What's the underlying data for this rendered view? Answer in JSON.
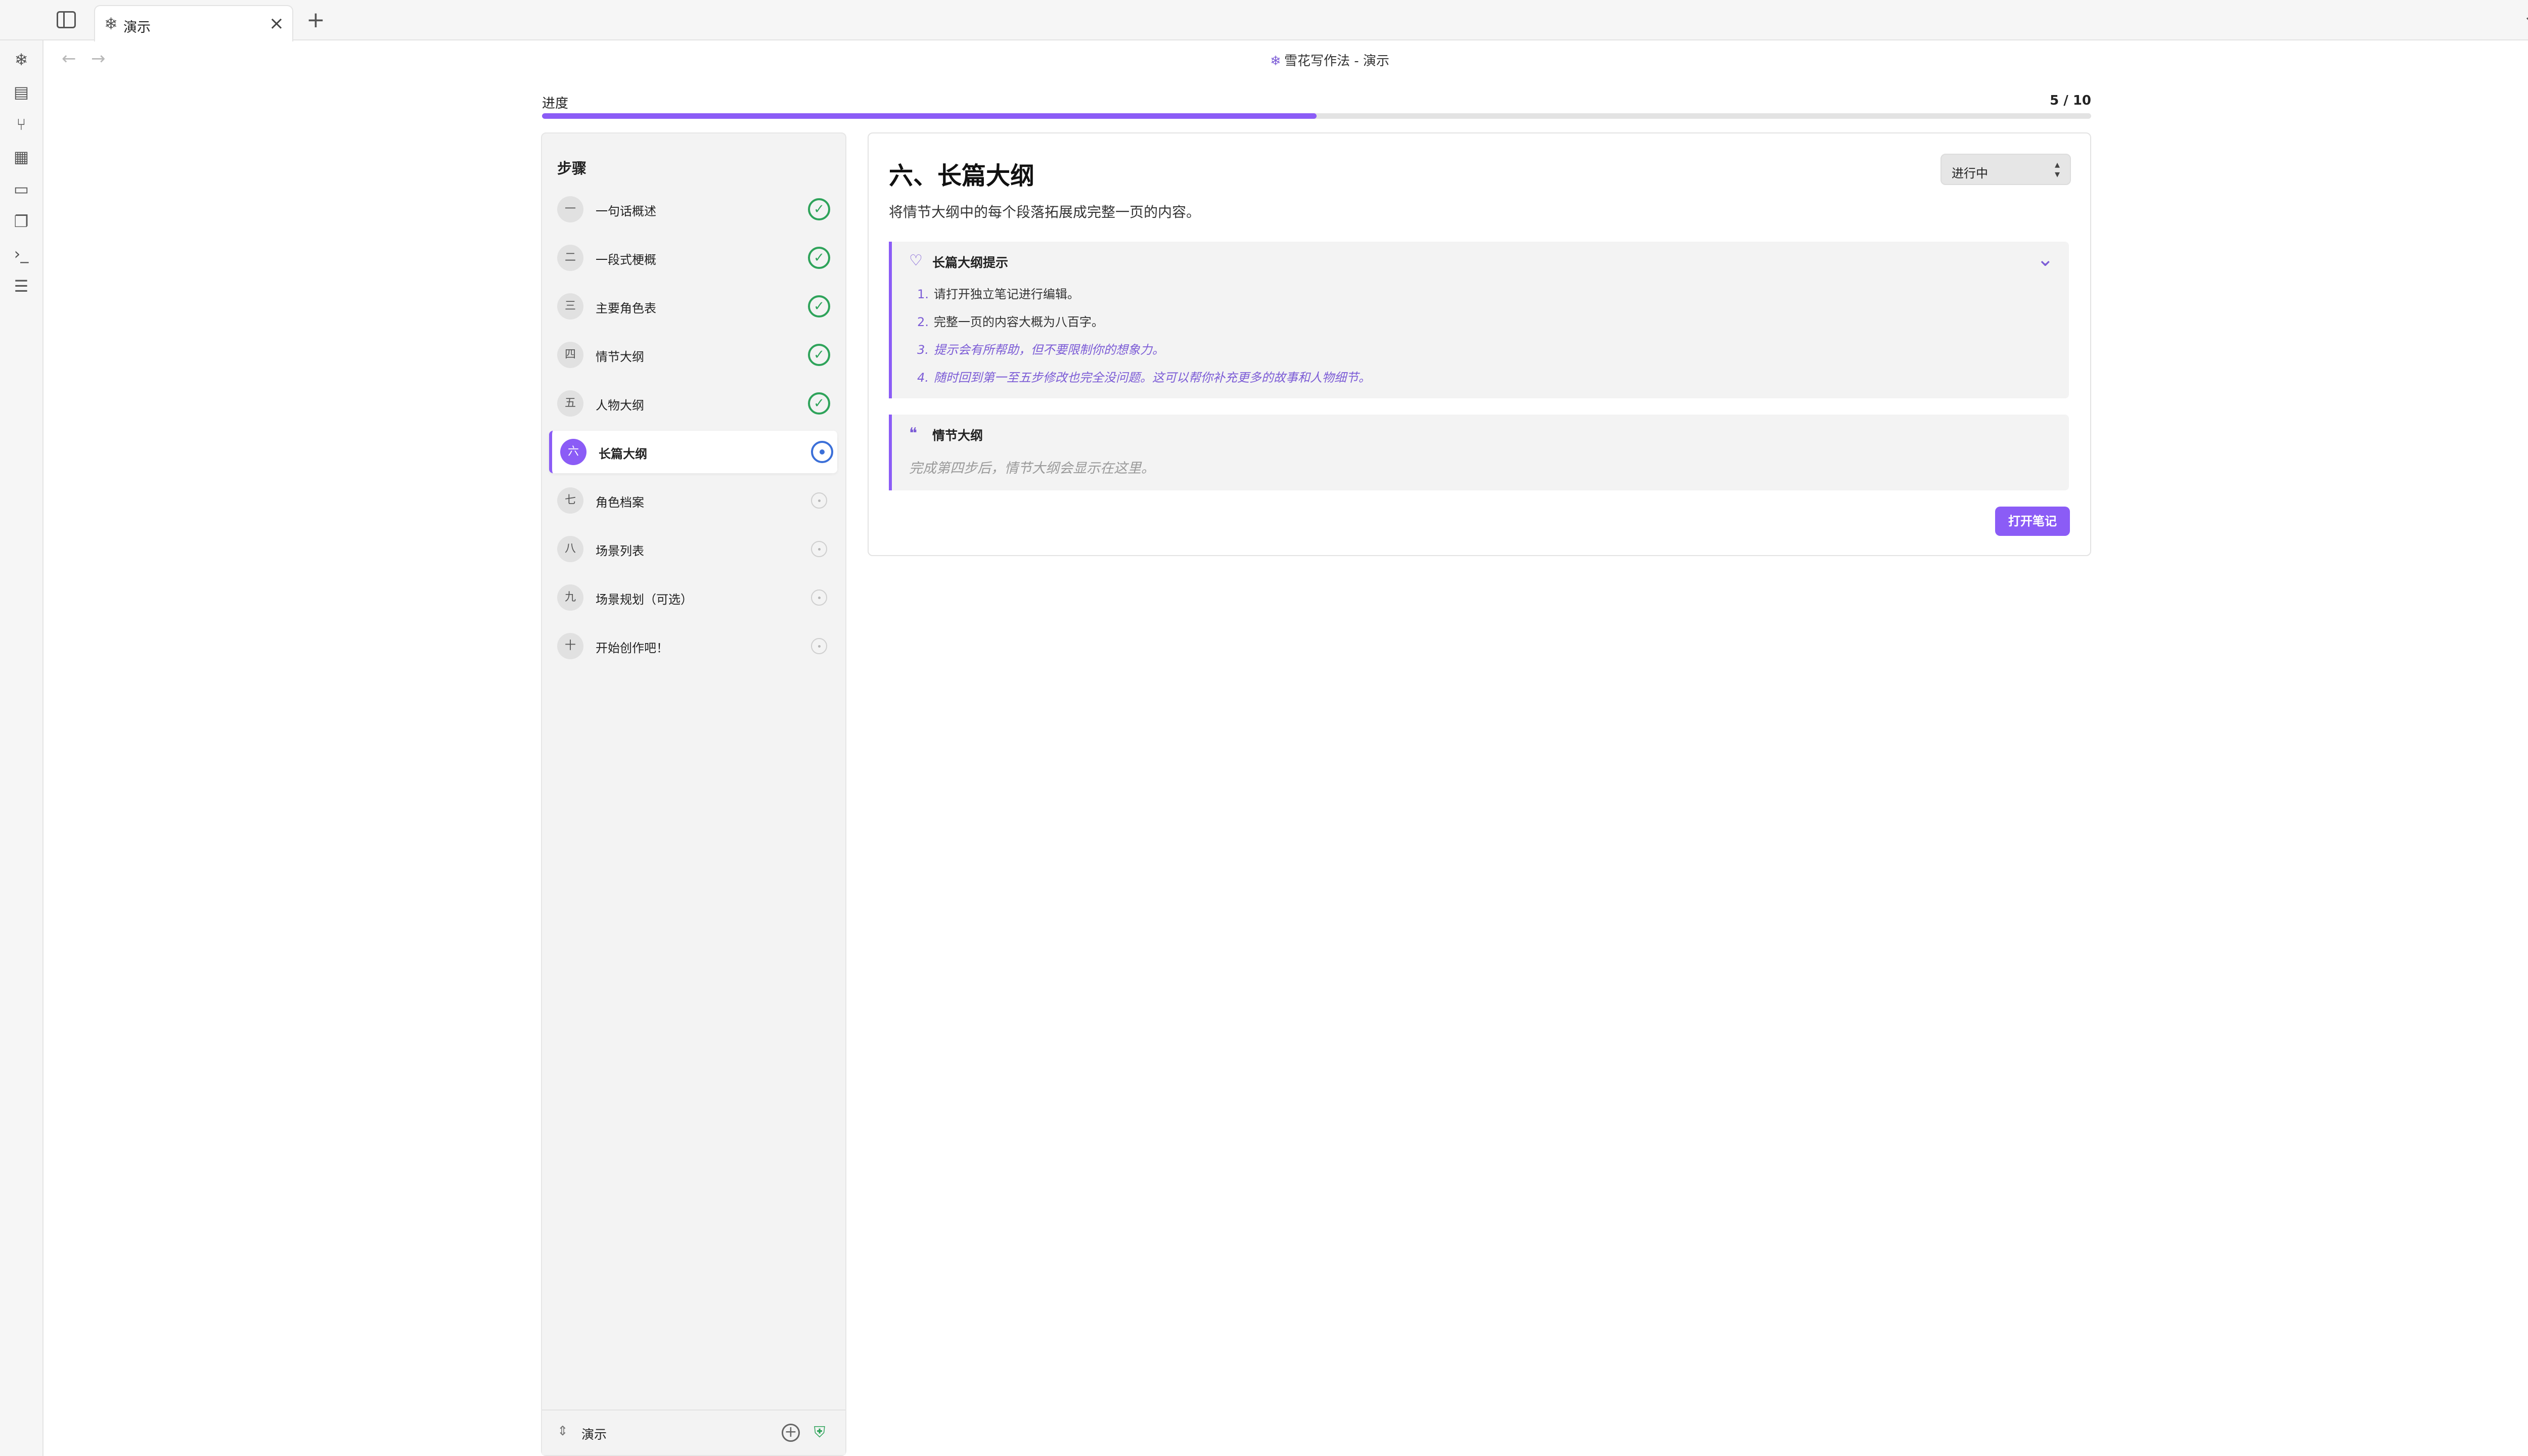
{
  "tabbar": {
    "tab_title": "演示",
    "tab_icon": "snowflake-icon"
  },
  "ribbon": {
    "icons": [
      "snowflake-icon",
      "file-icon",
      "graph-icon",
      "grid-icon",
      "calendar-icon",
      "copy-icon",
      "terminal-icon",
      "list-icon"
    ]
  },
  "header": {
    "title": "雪花写作法 - 演示"
  },
  "progress": {
    "label": "进度",
    "count": "5 / 10",
    "value": 0.5
  },
  "steps": {
    "title": "步骤",
    "items": [
      {
        "num": "一",
        "label": "一句话概述",
        "status": "done"
      },
      {
        "num": "二",
        "label": "一段式梗概",
        "status": "done"
      },
      {
        "num": "三",
        "label": "主要角色表",
        "status": "done"
      },
      {
        "num": "四",
        "label": "情节大纲",
        "status": "done"
      },
      {
        "num": "五",
        "label": "人物大纲",
        "status": "done"
      },
      {
        "num": "六",
        "label": "长篇大纲",
        "status": "current"
      },
      {
        "num": "七",
        "label": "角色档案",
        "status": "todo"
      },
      {
        "num": "八",
        "label": "场景列表",
        "status": "todo"
      },
      {
        "num": "九",
        "label": "场景规划（可选）",
        "status": "todo"
      },
      {
        "num": "十",
        "label": "开始创作吧！",
        "status": "todo"
      }
    ],
    "footer_label": "演示"
  },
  "main": {
    "heading": "六、长篇大纲",
    "status": "进行中",
    "description": "将情节大纲中的每个段落拓展成完整一页的内容。",
    "tips": {
      "title": "长篇大纲提示",
      "items": [
        {
          "num": "1.",
          "text": "请打开独立笔记进行编辑。"
        },
        {
          "num": "2.",
          "text": "完整一页的内容大概为八百字。"
        },
        {
          "num": "3.",
          "text": "提示会有所帮助，但不要限制你的想象力。"
        },
        {
          "num": "4.",
          "text": "随时回到第一至五步修改也完全没问题。这可以帮你补充更多的故事和人物细节。"
        }
      ]
    },
    "plot": {
      "title": "情节大纲",
      "placeholder": "完成第四步后，情节大纲会显示在这里。"
    },
    "open_note_label": "打开笔记"
  },
  "colors": {
    "accent": "#8b5cf6",
    "done": "#2ea35a",
    "current": "#3b6fd8"
  }
}
